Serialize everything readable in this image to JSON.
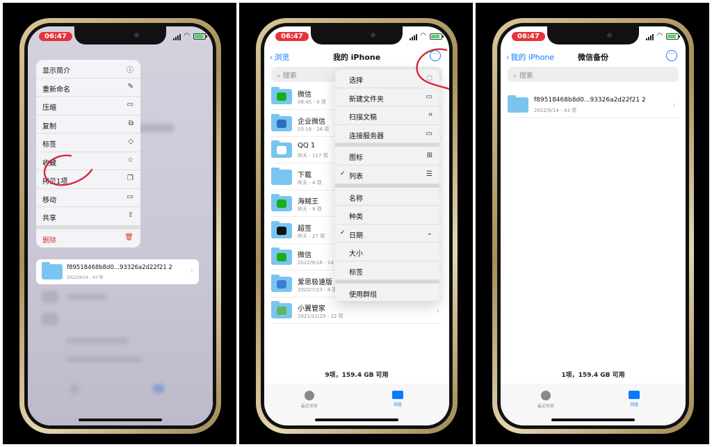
{
  "common": {
    "time": "06:47",
    "tabs": [
      {
        "label": "最近项目"
      },
      {
        "label": "浏览"
      }
    ]
  },
  "panel1": {
    "menu": [
      {
        "label": "显示简介",
        "icon": "info-icon",
        "glyph": "ⓘ"
      },
      {
        "label": "重新命名",
        "icon": "pencil-icon",
        "glyph": "✎"
      },
      {
        "label": "压缩",
        "icon": "archive-icon",
        "glyph": "▭"
      },
      {
        "label": "复制",
        "icon": "duplicate-icon",
        "glyph": "⧉"
      },
      {
        "label": "标签",
        "icon": "tag-icon",
        "glyph": "◇"
      },
      {
        "label": "收藏",
        "icon": "star-icon",
        "glyph": "☆"
      },
      {
        "label": "拷贝1项",
        "icon": "copy-icon",
        "glyph": "❐"
      },
      {
        "label": "移动",
        "icon": "folder-icon",
        "glyph": "▭"
      },
      {
        "label": "共享",
        "icon": "share-icon",
        "glyph": "⇧"
      },
      {
        "label": "删除",
        "icon": "trash-icon",
        "glyph": "🗑"
      }
    ],
    "preview": {
      "name": "f89518468b8d0...93326a2d22f21 2",
      "meta": "2022/9/14 - 43 项"
    },
    "annotation_color": "#d6283a"
  },
  "panel2": {
    "back_label": "浏览",
    "title": "我的 iPhone",
    "search_placeholder": "搜索",
    "rows": [
      {
        "name": "微信",
        "meta": "06:45 - 9 项",
        "badge": "#1aad19"
      },
      {
        "name": "企业微信",
        "meta": "03:16 - 26 项",
        "badge": "#2d6fbf"
      },
      {
        "name": "QQ 1",
        "meta": "昨天 - 117 项",
        "badge": "#ffffff"
      },
      {
        "name": "下载",
        "meta": "昨天 - 4 项",
        "badge": "#79c5ef"
      },
      {
        "name": "海贼王",
        "meta": "昨天 - 9 项",
        "badge": "#1aad19"
      },
      {
        "name": "超签",
        "meta": "昨天 - 27 项",
        "badge": "#111111"
      },
      {
        "name": "微信",
        "meta": "2022/9/16 - 14 项",
        "badge": "#1aad19"
      },
      {
        "name": "爱思极速版",
        "meta": "2022/7/23 - 4 项",
        "badge": "#3b7ed8"
      },
      {
        "name": "小翼管家",
        "meta": "2021/12/29 - 22 项",
        "badge": "#5ab75a"
      }
    ],
    "dropdown": [
      {
        "label": "选择",
        "glyph": "◌",
        "check": ""
      },
      {
        "label": "新建文件夹",
        "glyph": "▭",
        "check": ""
      },
      {
        "label": "扫描文稿",
        "glyph": "⌗",
        "check": ""
      },
      {
        "label": "连接服务器",
        "glyph": "▭",
        "check": ""
      },
      {
        "sep": true
      },
      {
        "label": "图标",
        "glyph": "⊞",
        "check": ""
      },
      {
        "label": "列表",
        "glyph": "☰",
        "check": "✓"
      },
      {
        "sep": true
      },
      {
        "label": "名称",
        "glyph": "",
        "check": ""
      },
      {
        "label": "种类",
        "glyph": "",
        "check": ""
      },
      {
        "label": "日期",
        "glyph": "⌄",
        "check": "✓"
      },
      {
        "label": "大小",
        "glyph": "",
        "check": ""
      },
      {
        "label": "标签",
        "glyph": "",
        "check": ""
      },
      {
        "sep": true
      },
      {
        "label": "使用群组",
        "glyph": "",
        "check": ""
      }
    ],
    "footer": "9项，159.4 GB 可用"
  },
  "panel3": {
    "back_label": "我的 iPhone",
    "title": "微信备份",
    "search_placeholder": "搜索",
    "rows": [
      {
        "name": "f89518468b8d0...93326a2d22f21 2",
        "meta": "2022/9/14 - 43 项"
      }
    ],
    "footer": "1项，159.4 GB 可用"
  }
}
